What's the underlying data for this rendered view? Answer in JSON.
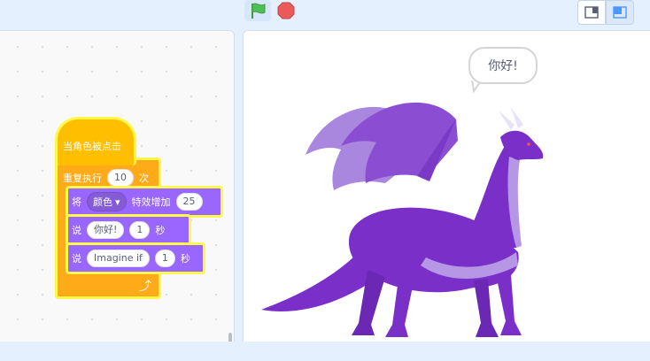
{
  "toolbar": {
    "green_flag_icon": "green-flag-icon",
    "stop_icon": "stop-sign-icon",
    "layout_small_icon": "small-stage-icon",
    "layout_normal_icon": "normal-stage-icon",
    "colors": {
      "flag": "#4cbf56",
      "stop": "#ec5959"
    }
  },
  "script": {
    "hat_label": "当角色被点击",
    "repeat_label": "重复执行",
    "repeat_count": "10",
    "repeat_unit": "次",
    "effect_block": {
      "prefix": "将",
      "effect": "颜色",
      "mid": "特效增加",
      "value": "25"
    },
    "say1": {
      "prefix": "说",
      "text": "你好!",
      "secs": "1",
      "unit": "秒"
    },
    "say2": {
      "prefix": "说",
      "text": "Imagine if",
      "secs": "1",
      "unit": "秒"
    },
    "colors": {
      "events": "#ffbf00",
      "control": "#ffab19",
      "looks": "#9966ff",
      "glow": "#fff84a"
    }
  },
  "stage": {
    "speech_bubble": "你好!",
    "sprite_icon": "purple-dragon",
    "sprite_color": "#7b2fc9"
  }
}
